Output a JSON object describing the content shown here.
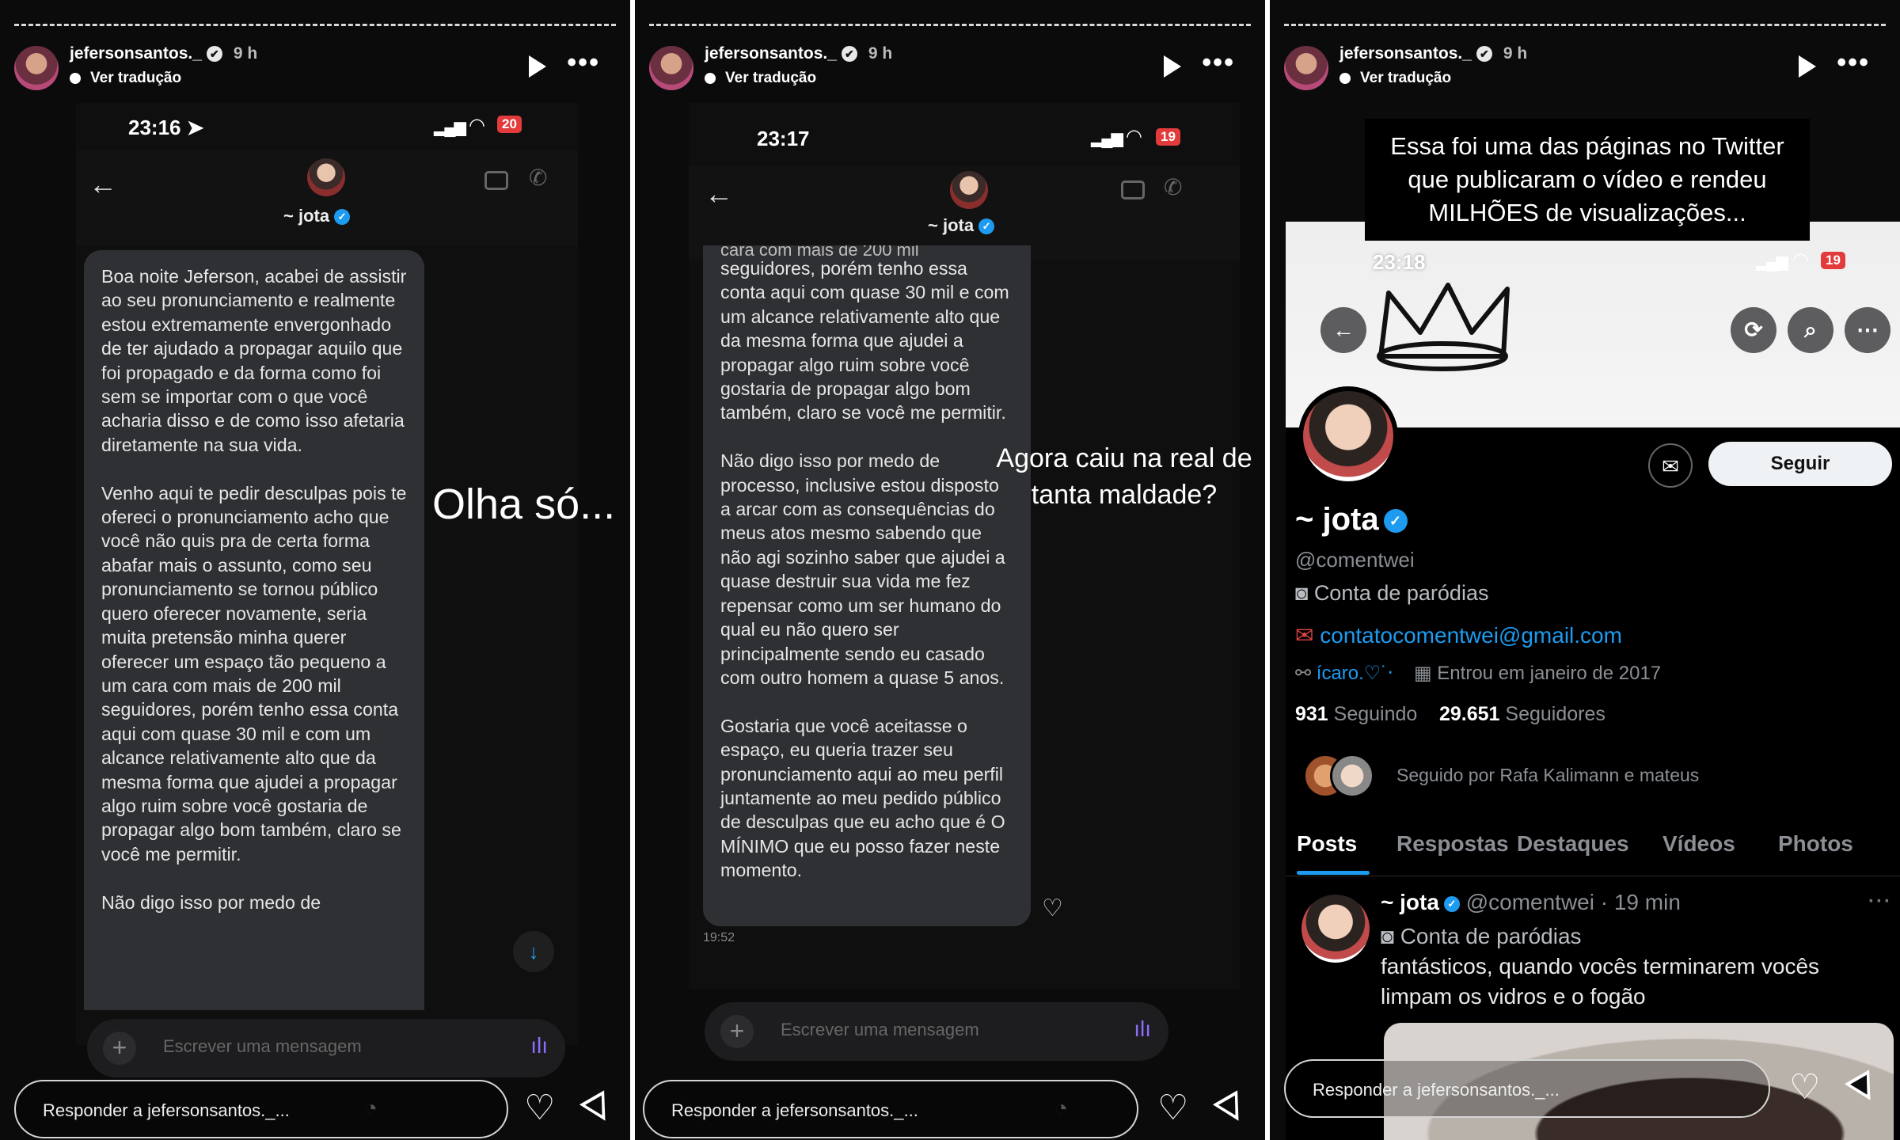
{
  "story": {
    "username": "jefersonsantos._",
    "verified_mark": "✔",
    "time": "9 h",
    "translate_label": "Ver tradução",
    "more_label": "•••",
    "reply_placeholder": "Responder a jefersonsantos._...",
    "reply_placeholder_2": "Responder a jefersonsantos._...",
    "reply_placeholder_3": "Responder a jefersonsantos._...",
    "heart_glyph": "♡"
  },
  "panel1": {
    "status_time": "23:16",
    "battery": "20",
    "chat_name": "~ jota",
    "message": "Boa noite Jeferson, acabei de assistir ao seu pronunciamento e realmente estou extremamente envergonhado de ter ajudado a propagar aquilo que foi propagado e da forma como foi sem se importar com o que você acharia disso e de como isso afetaria diretamente na sua vida.\n\nVenho aqui te pedir desculpas pois te ofereci o pronunciamento acho que você não quis pra de certa forma abafar mais o assunto, como seu pronunciamento se tornou público quero oferecer novamente, seria muita pretensão minha querer oferecer um espaço tão pequeno a um cara com mais de 200 mil seguidores, porém tenho essa conta aqui com quase 30 mil e com um alcance relativamente alto que da mesma forma que ajudei a propagar algo ruim sobre você gostaria de propagar algo bom também, claro se você me permitir.\n\nNão digo isso por medo de",
    "overlay_text": "Olha só...",
    "input_placeholder": "Escrever uma mensagem"
  },
  "panel2": {
    "status_time": "23:17",
    "battery": "19",
    "chat_name": "~ jota",
    "message_top_cut": "cara com mais de 200 mil",
    "message": "seguidores, porém tenho essa conta aqui com quase 30 mil e com um alcance relativamente alto que da mesma forma que ajudei a propagar algo ruim sobre você gostaria de propagar algo bom também, claro se você me permitir.\n\nNão digo isso por medo de processo, inclusive estou disposto a arcar com as consequências do meus atos mesmo sabendo que não agi sozinho saber que ajudei a quase destruir sua vida me fez repensar como um ser humano do qual eu não quero ser principalmente sendo eu casado com outro homem a quase 5 anos.\n\nGostaria que você aceitasse o espaço, eu queria trazer seu pronunciamento aqui ao meu perfil juntamente ao meu pedido público de desculpas que eu acho que é O MÍNIMO que eu posso fazer neste momento.",
    "timestamp": "19:52",
    "overlay_text": "Agora caiu na real de tanta maldade?",
    "input_placeholder": "Escrever uma mensagem"
  },
  "panel3": {
    "caption": "Essa foi uma das páginas no Twitter que publicaram o vídeo e rendeu MILHÕES de visualizações...",
    "status_time": "23:18",
    "battery": "19",
    "follow_label": "Seguir",
    "profile_name": "~ jota",
    "handle": "@comentwei",
    "bio": "Conta de paródias",
    "email": "contatocomentwei@gmail.com",
    "link": "ícaro.♡˙‧",
    "joined": "Entrou em janeiro de 2017",
    "following_count": "931",
    "following_label": "Seguindo",
    "followers_count": "29.651",
    "followers_label": "Seguidores",
    "followed_by": "Seguido por Rafa Kalimann e mateus",
    "tabs": [
      "Posts",
      "Respostas",
      "Destaques",
      "Vídeos",
      "Photos"
    ],
    "tweet": {
      "name": "~ jota",
      "meta": "@comentwei · 19 min",
      "bio": "Conta de paródias",
      "text": "fantásticos, quando vocês terminarem vocês limpam os vidros e o fogão"
    }
  },
  "colors": {
    "accent_blue": "#1d9bf0",
    "battery_red": "#e33b3b",
    "bubble_bg": "#2f3033"
  }
}
